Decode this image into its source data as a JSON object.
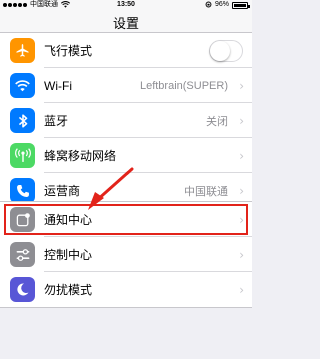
{
  "status_bar": {
    "carrier": "中国联通",
    "time": "13:50",
    "battery": "96%",
    "battery_level": 0.96
  },
  "nav": {
    "title": "设置"
  },
  "groups": [
    {
      "items": [
        {
          "label": "飞行模式",
          "icon": "airplane-icon",
          "color": "#ff9500",
          "control": "toggle",
          "toggle_on": false
        },
        {
          "label": "Wi-Fi",
          "icon": "wifi-icon",
          "color": "#007aff",
          "value": "Leftbrain(SUPER)"
        },
        {
          "label": "蓝牙",
          "icon": "bluetooth-icon",
          "color": "#007aff",
          "value": "关闭"
        },
        {
          "label": "蜂窝移动网络",
          "icon": "cellular-icon",
          "color": "#4cd964",
          "value": ""
        },
        {
          "label": "运营商",
          "icon": "phone-icon",
          "color": "#007aff",
          "value": "中国联通"
        }
      ]
    },
    {
      "items": [
        {
          "label": "通知中心",
          "icon": "notification-center-icon",
          "color": "#8e8e93",
          "value": "",
          "highlighted": true
        },
        {
          "label": "控制中心",
          "icon": "control-center-icon",
          "color": "#8e8e93",
          "value": ""
        },
        {
          "label": "勿扰模式",
          "icon": "moon-icon",
          "color": "#5856d6",
          "value": ""
        }
      ]
    }
  ],
  "annotation": {
    "highlight_color": "#e2231a"
  }
}
